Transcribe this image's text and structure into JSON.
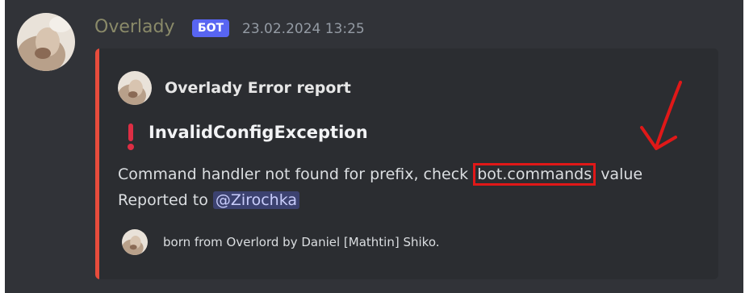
{
  "message": {
    "author": "Overlady",
    "bot_tag": "БОТ",
    "timestamp": "23.02.2024 13:25"
  },
  "embed": {
    "accent_color": "#e74c3c",
    "author_name": "Overlady Error report",
    "title_icon": "exclamation-icon",
    "title": "InvalidConfigException",
    "description_prefix": "Command handler not found for prefix, check",
    "description_code": "bot.commands",
    "description_suffix": "value",
    "reported_prefix": "Reported to",
    "reported_mention": "@Zirochka",
    "footer_text": "born from Overlord by Daniel [Mathtin] Shiko."
  },
  "annotation": {
    "icon": "red-arrow-icon",
    "color": "#e01818"
  },
  "colors": {
    "chat_background": "#313338",
    "embed_background": "#2b2d31",
    "bot_tag": "#5865f2",
    "mention_background": "#3c4270"
  }
}
